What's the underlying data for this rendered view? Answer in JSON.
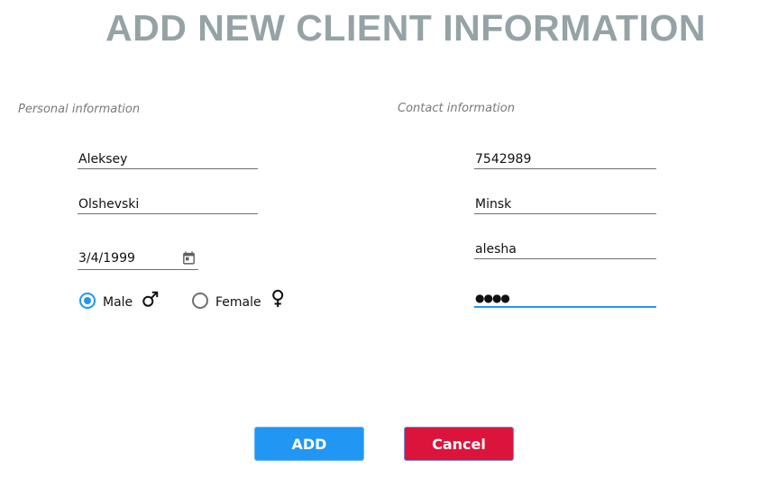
{
  "page": {
    "title": "ADD NEW CLIENT INFORMATION"
  },
  "personal": {
    "section_label": "Personal information",
    "first_name": "Aleksey",
    "last_name": "Olshevski",
    "birth_date": "3/4/1999",
    "gender": {
      "options": [
        {
          "label": "Male",
          "selected": true,
          "icon": "male-icon"
        },
        {
          "label": "Female",
          "selected": false,
          "icon": "female-icon"
        }
      ]
    }
  },
  "contact": {
    "section_label": "Contact information",
    "phone": "7542989",
    "city": "Minsk",
    "login": "alesha",
    "password_masked": "●●●●"
  },
  "actions": {
    "add_label": "ADD",
    "cancel_label": "Cancel"
  },
  "colors": {
    "title": "#95a3a6",
    "accent": "#2196f3",
    "cancel": "#dc143c"
  }
}
